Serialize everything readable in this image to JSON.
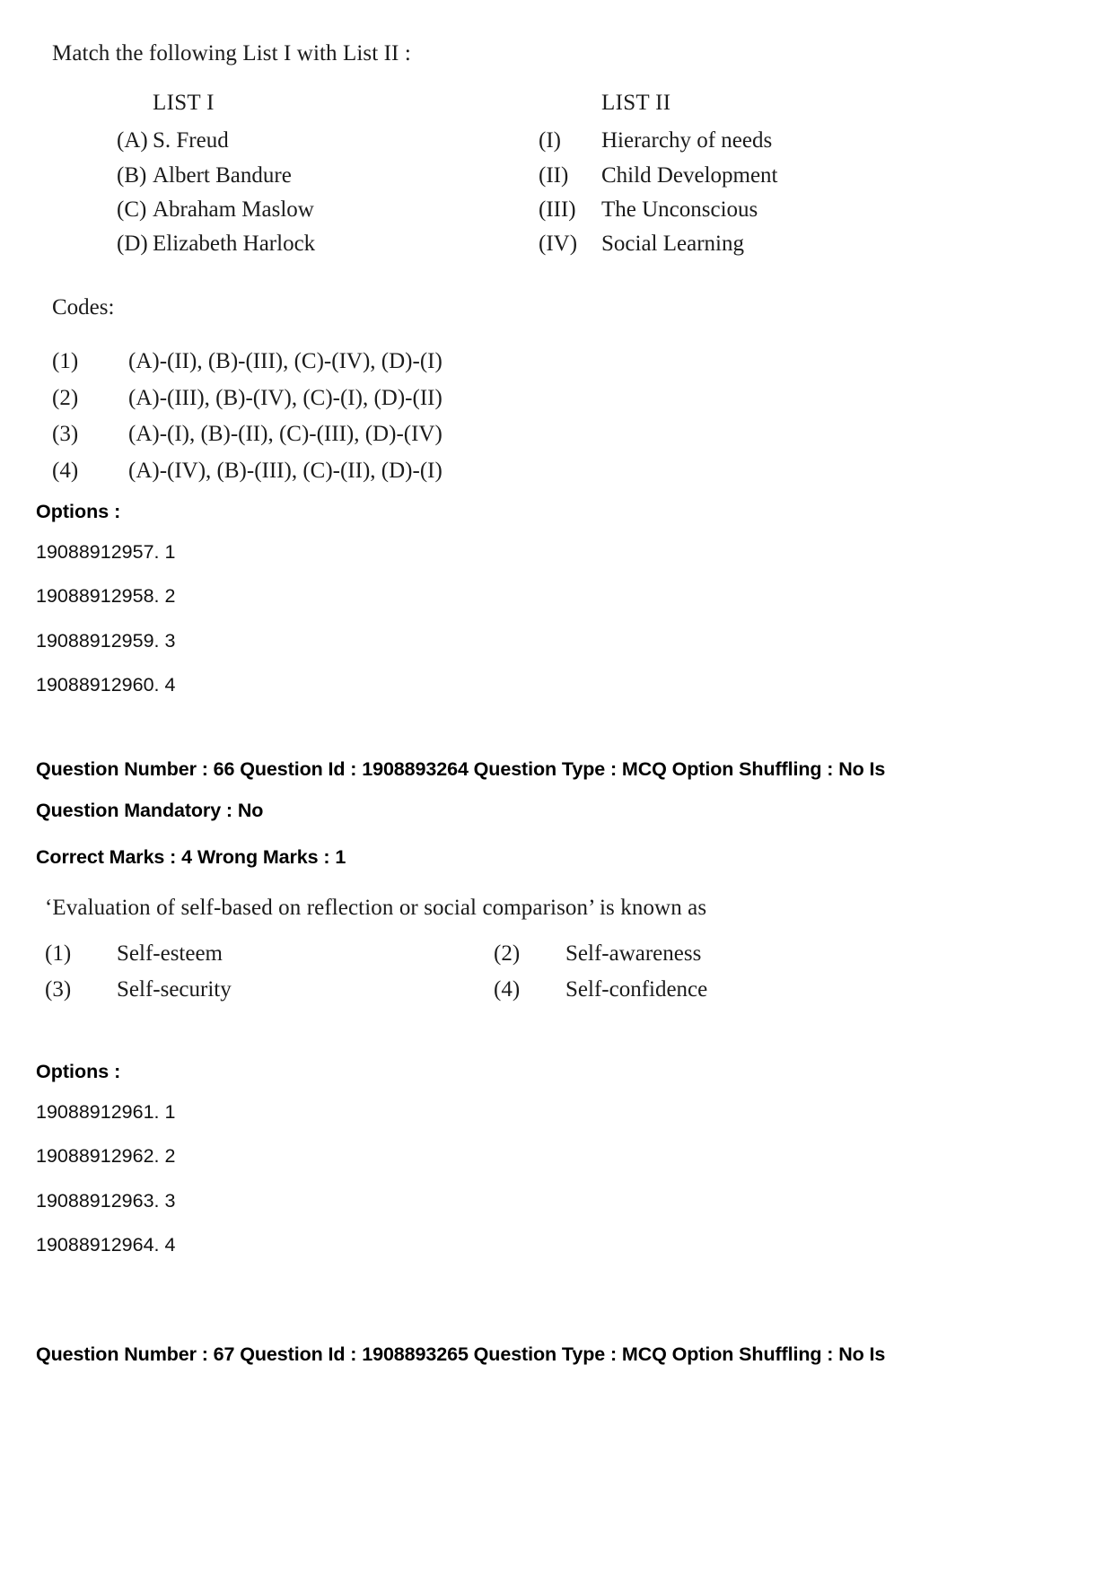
{
  "document": {
    "type": "exam-question-paper"
  },
  "question_65": {
    "stem": "Match the following List I with List II :",
    "list_i": {
      "heading": "LIST I",
      "items": [
        {
          "tag": "(A)",
          "text": "S. Freud"
        },
        {
          "tag": "(B)",
          "text": "Albert Bandure"
        },
        {
          "tag": "(C)",
          "text": "Abraham Maslow"
        },
        {
          "tag": "(D)",
          "text": "Elizabeth Harlock"
        }
      ]
    },
    "list_ii": {
      "heading": "LIST II",
      "items": [
        {
          "tag": "(I)",
          "text": "Hierarchy of needs"
        },
        {
          "tag": "(II)",
          "text": "Child Development"
        },
        {
          "tag": "(III)",
          "text": "The Unconscious"
        },
        {
          "tag": "(IV)",
          "text": "Social Learning"
        }
      ]
    },
    "codes_label": "Codes:",
    "codes": [
      {
        "num": "(1)",
        "value": "(A)-(II), (B)-(III), (C)-(IV), (D)-(I)"
      },
      {
        "num": "(2)",
        "value": "(A)-(III), (B)-(IV), (C)-(I), (D)-(II)"
      },
      {
        "num": "(3)",
        "value": "(A)-(I), (B)-(II), (C)-(III), (D)-(IV)"
      },
      {
        "num": "(4)",
        "value": "(A)-(IV), (B)-(III), (C)-(II), (D)-(I)"
      }
    ],
    "options_label": "Options :",
    "options": [
      "19088912957. 1",
      "19088912958. 2",
      "19088912959. 3",
      "19088912960. 4"
    ]
  },
  "question_66": {
    "header_line_1": "Question Number : 66 Question Id : 1908893264 Question Type : MCQ Option Shuffling : No Is",
    "header_line_2": "Question Mandatory : No",
    "marks_line": "Correct Marks : 4 Wrong Marks : 1",
    "stem": "‘Evaluation of self-based on reflection or social comparison’ is known as",
    "choices": [
      {
        "num": "(1)",
        "text": "Self-esteem"
      },
      {
        "num": "(2)",
        "text": "Self-awareness"
      },
      {
        "num": "(3)",
        "text": "Self-security"
      },
      {
        "num": "(4)",
        "text": "Self-confidence"
      }
    ],
    "options_label": "Options :",
    "options": [
      "19088912961. 1",
      "19088912962. 2",
      "19088912963. 3",
      "19088912964. 4"
    ]
  },
  "question_67": {
    "header_line_1": "Question Number : 67 Question Id : 1908893265 Question Type : MCQ Option Shuffling : No Is"
  }
}
